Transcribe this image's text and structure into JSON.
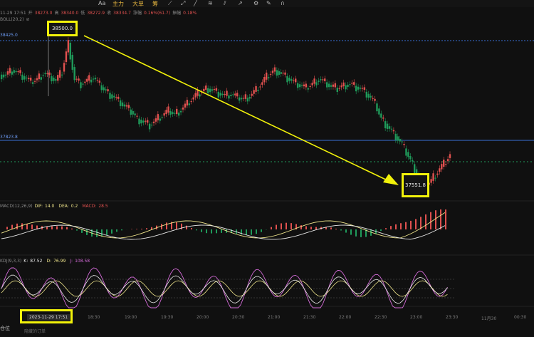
{
  "toolbar": {
    "items": [
      "Aa",
      "主力",
      "大单",
      "筹"
    ]
  },
  "ohlc_header": {
    "time": "11-29 17:51",
    "open_label": "开",
    "open": "38273.0",
    "high_label": "高",
    "high": "38340.0",
    "low_label": "低",
    "low": "38272.9",
    "close_label": "收",
    "close": "38334.7",
    "change_label": "涨幅",
    "change": "0.16%(61.7)",
    "amp_label": "振幅",
    "amp": "0.18%"
  },
  "boll_label": "BOLL(20,2)",
  "price_lines": {
    "upper_label": "38425.0",
    "lower_label": "37823.8"
  },
  "callouts": {
    "high": "38500.0",
    "low": "37551.8"
  },
  "macd_header": {
    "name": "MACD(12,26,9)",
    "dif_label": "DIF:",
    "dif": "14.0",
    "dea_label": "DEA:",
    "dea": "0.2",
    "macd_label": "MACD:",
    "macd": "28.5"
  },
  "kdj_header": {
    "name": "KDJ(9,3,3)",
    "k_label": "K:",
    "k": "87.52",
    "d_label": "D:",
    "d": "76.99",
    "j_label": "J:",
    "j": "108.58"
  },
  "time_axis": {
    "crosshair_date": "2023-11-29 17:51",
    "ticks": [
      "18:30",
      "19:00",
      "19:30",
      "20:00",
      "20:30",
      "21:00",
      "21:30",
      "22:00",
      "22:30",
      "23:00",
      "23:30",
      "11月30",
      "00:30"
    ]
  },
  "footer": {
    "left": "仓位",
    "sub": "隐藏的订单"
  },
  "colors": {
    "up": "#e0514f",
    "down": "#1f9a5a",
    "accent": "#f2f20a",
    "line_blue": "#3a6fd6",
    "macd_dif": "#f0e68c",
    "kdj_j": "#d46bd8"
  },
  "chart_data": {
    "type": "candlestick",
    "series": [
      {
        "name": "K线",
        "values": [
          38290,
          38320,
          38300,
          38270,
          38240,
          38260,
          38300,
          38280,
          38250,
          38310,
          38500,
          38260,
          38230,
          38250,
          38270,
          38220,
          38180,
          38150,
          38120,
          38080,
          38050,
          38000,
          37980,
          37960,
          37990,
          38020,
          38050,
          38030,
          38060,
          38100,
          38140,
          38170,
          38200,
          38190,
          38170,
          38150,
          38160,
          38140,
          38130,
          38150,
          38190,
          38240,
          38290,
          38320,
          38300,
          38270,
          38240,
          38220,
          38200,
          38230,
          38260,
          38240,
          38210,
          38200,
          38220,
          38230,
          38210,
          38190,
          38150,
          38100,
          38000,
          37950,
          37900,
          37850,
          37780,
          37700,
          37600,
          37551.8,
          37590,
          37650,
          37700,
          37760
        ]
      }
    ],
    "macd": {
      "dif": 14.0,
      "dea": 0.2,
      "macd": 28.5
    },
    "kdj": {
      "k": 87.52,
      "d": 76.99,
      "j": 108.58
    },
    "annotations": [
      "38500.0",
      "37551.8"
    ]
  }
}
